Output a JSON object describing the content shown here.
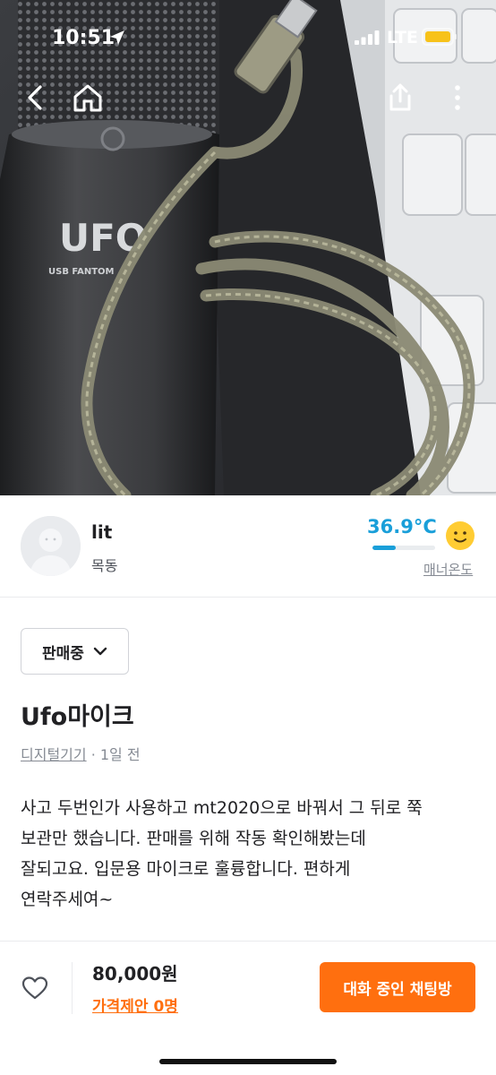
{
  "status_bar": {
    "time": "10:51",
    "carrier": "LTE",
    "battery_color": "#f7c21a"
  },
  "nav": {
    "back_icon": "chevron-left-icon",
    "home_icon": "home-icon",
    "share_icon": "share-icon",
    "more_icon": "more-vertical-icon"
  },
  "seller": {
    "name": "lit",
    "region": "목동",
    "temperature": "36.9°C",
    "temperature_level": 0.369,
    "temperature_color": "#1a9fd9",
    "manner_label": "매너온도"
  },
  "product": {
    "status_label": "판매중",
    "title": "Ufo마이크",
    "category": "디지털기기",
    "time_ago": "· 1일 전",
    "description_lines": [
      "사고 두번인가 사용하고 mt2020으로 바꿔서 그 뒤로 쭉",
      "보관만 했습니다. 판매를 위해 작동 확인해봤는데",
      "잘되고요. 입문용 마이크로 훌륭합니다. 편하게",
      "연락주세여~"
    ]
  },
  "bottom": {
    "price": "80,000원",
    "offer_label": "가격제안 0명",
    "chat_button": "대화 중인 채팅방",
    "accent_color": "#ff6f0f"
  }
}
